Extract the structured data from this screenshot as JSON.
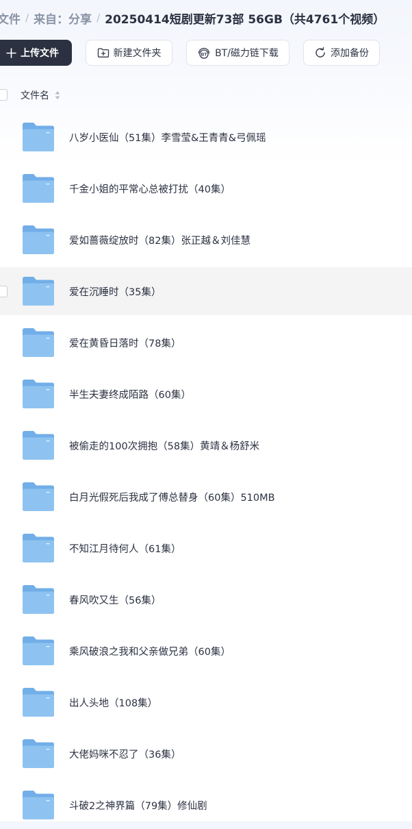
{
  "breadcrumb": {
    "items": [
      "文件",
      "来自：分享"
    ],
    "separator": "/",
    "current": "20250414短剧更新73部 56GB（共4761个视频）"
  },
  "toolbar": {
    "upload_label": "上传文件",
    "new_folder_label": "新建文件夹",
    "bt_label": "BT/磁力链下载",
    "backup_label": "添加备份",
    "bt_badge": "BT"
  },
  "table": {
    "column_name": "文件名",
    "rows": [
      {
        "name": "八岁小医仙（51集）李雪莹&王青青&弓佩瑶"
      },
      {
        "name": "千金小姐的平常心总被打扰（40集）"
      },
      {
        "name": "爱如蔷薇绽放时（82集）张正越＆刘佳慧"
      },
      {
        "name": "爱在沉睡时（35集）"
      },
      {
        "name": "爱在黄昏日落时（78集）"
      },
      {
        "name": "半生夫妻终成陌路（60集）"
      },
      {
        "name": "被偷走的100次拥抱（58集）黄靖＆杨舒米"
      },
      {
        "name": "白月光假死后我成了傅总替身（60集）510MB"
      },
      {
        "name": "不知江月待何人（61集）"
      },
      {
        "name": "春风吹又生（56集）"
      },
      {
        "name": "乘风破浪之我和父亲做兄弟（60集）"
      },
      {
        "name": "出人头地（108集）"
      },
      {
        "name": "大佬妈咪不忍了（36集）"
      },
      {
        "name": "斗破2之神界篇（79集）修仙剧"
      }
    ],
    "hovered_row": 3
  },
  "colors": {
    "primary_button": "#2b3140",
    "folder_back": "#72aee8",
    "folder_front": "#8ec3f1",
    "row_hover": "#f4f4f5"
  }
}
